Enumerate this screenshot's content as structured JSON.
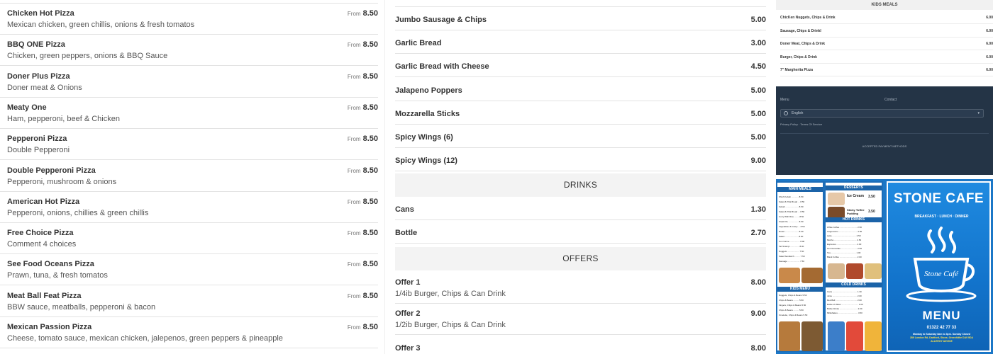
{
  "pizzas": [
    {
      "name": "Chicken Hot Pizza",
      "desc": "Mexican chicken, green chillis, onions & fresh tomatos",
      "from": "From",
      "price": "8.50"
    },
    {
      "name": "BBQ ONE Pizza",
      "desc": "Chicken, green peppers, onions & BBQ Sauce",
      "from": "From",
      "price": "8.50"
    },
    {
      "name": "Doner Plus Pizza",
      "desc": "Doner meat & Onions",
      "from": "From",
      "price": "8.50"
    },
    {
      "name": "Meaty One",
      "desc": "Ham, pepperoni, beef & Chicken",
      "from": "From",
      "price": "8.50"
    },
    {
      "name": "Pepperoni Pizza",
      "desc": "Double Pepperoni",
      "from": "From",
      "price": "8.50"
    },
    {
      "name": "Double Pepperoni Pizza",
      "desc": "Pepperoni, mushroom & onions",
      "from": "From",
      "price": "8.50"
    },
    {
      "name": "American Hot Pizza",
      "desc": "Pepperoni, onions, chillies & green chillis",
      "from": "From",
      "price": "8.50"
    },
    {
      "name": "Free Choice Pizza",
      "desc": "Comment 4 choices",
      "from": "From",
      "price": "8.50"
    },
    {
      "name": "See Food Oceans Pizza",
      "desc": "Prawn, tuna, & fresh tomatos",
      "from": "From",
      "price": "8.50"
    },
    {
      "name": "Meat Ball Feat Pizza",
      "desc": "BBW sauce, meatballs, pepperoni & bacon",
      "from": "From",
      "price": "8.50"
    },
    {
      "name": "Mexican Passion Pizza",
      "desc": "Cheese, tomato sauce, mexican chicken, jalepenos, green peppers & pineapple",
      "from": "From",
      "price": "8.50"
    }
  ],
  "sides": [
    {
      "name": "Jumbo Sausage & Chips",
      "price": "5.00"
    },
    {
      "name": "Garlic Bread",
      "price": "3.00"
    },
    {
      "name": "Garlic Bread with Cheese",
      "price": "4.50"
    },
    {
      "name": "Jalapeno Poppers",
      "price": "5.00"
    },
    {
      "name": "Mozzarella Sticks",
      "price": "5.00"
    },
    {
      "name": "Spicy Wings (6)",
      "price": "5.00"
    },
    {
      "name": "Spicy Wings (12)",
      "price": "9.00"
    }
  ],
  "drinks": {
    "heading": "DRINKS",
    "items": [
      {
        "name": "Cans",
        "price": "1.30"
      },
      {
        "name": "Bottle",
        "price": "2.70"
      }
    ]
  },
  "offers": {
    "heading": "OFFERS",
    "items": [
      {
        "name": "Offer 1",
        "desc": "1/4ib Burger, Chips & Can Drink",
        "price": "8.00"
      },
      {
        "name": "Offer 2",
        "desc": "1/2ib Burger, Chips & Can Drink",
        "price": "9.00"
      },
      {
        "name": "Offer 3",
        "price": "8.00"
      }
    ]
  },
  "kids": {
    "heading": "KIDS MEALS",
    "items": [
      {
        "name": "ChicKen Nuggets, Chips & Drink",
        "price": "6.00"
      },
      {
        "name": "Sausage, Chips & Drinkl",
        "price": "6.00"
      },
      {
        "name": "Doner Meat, Chips & Drink",
        "price": "6.00"
      },
      {
        "name": "Burger, Chips & Drink",
        "price": "6.00"
      },
      {
        "name": "7\" Margherita Pizza",
        "price": "6.00"
      }
    ]
  },
  "footer": {
    "menu": "Menu",
    "contact": "Contact",
    "language": "English",
    "links": "Privacy Policy · Terms Of Service",
    "payment": "ACCEPTED PAYMENT METHODS"
  },
  "menu_image": {
    "main_meals": "MAIN MEALS",
    "desserts": "DESSERTS",
    "hot_drinks": "HOT DRINKS",
    "cold_drinks": "COLD DRINKS",
    "kids_menu": "KIDS MENU",
    "dessert_items": [
      {
        "name": "Ice Cream",
        "price": "3.50"
      },
      {
        "name": "Sticky Toffee Pudding",
        "price": "3.50"
      }
    ],
    "title": "STONE CAFE",
    "tagline": "BREAKFAST · LUNCH · DINNER",
    "cup_text": "Stone Café",
    "menu_word": "MENU",
    "phone": "01322 42 77 33",
    "hours": "Monday to Saturday 8am to 3pm. Sunday Closed",
    "address": "289 London Rd, Dartford, Stone, Greenhithe DA9 9DA",
    "allergy": "ALLERGY ADVICE"
  },
  "colors": {
    "menu_blue": "#1b77c7",
    "footer_navy": "#243446",
    "section_grey": "#f3f3f3"
  }
}
